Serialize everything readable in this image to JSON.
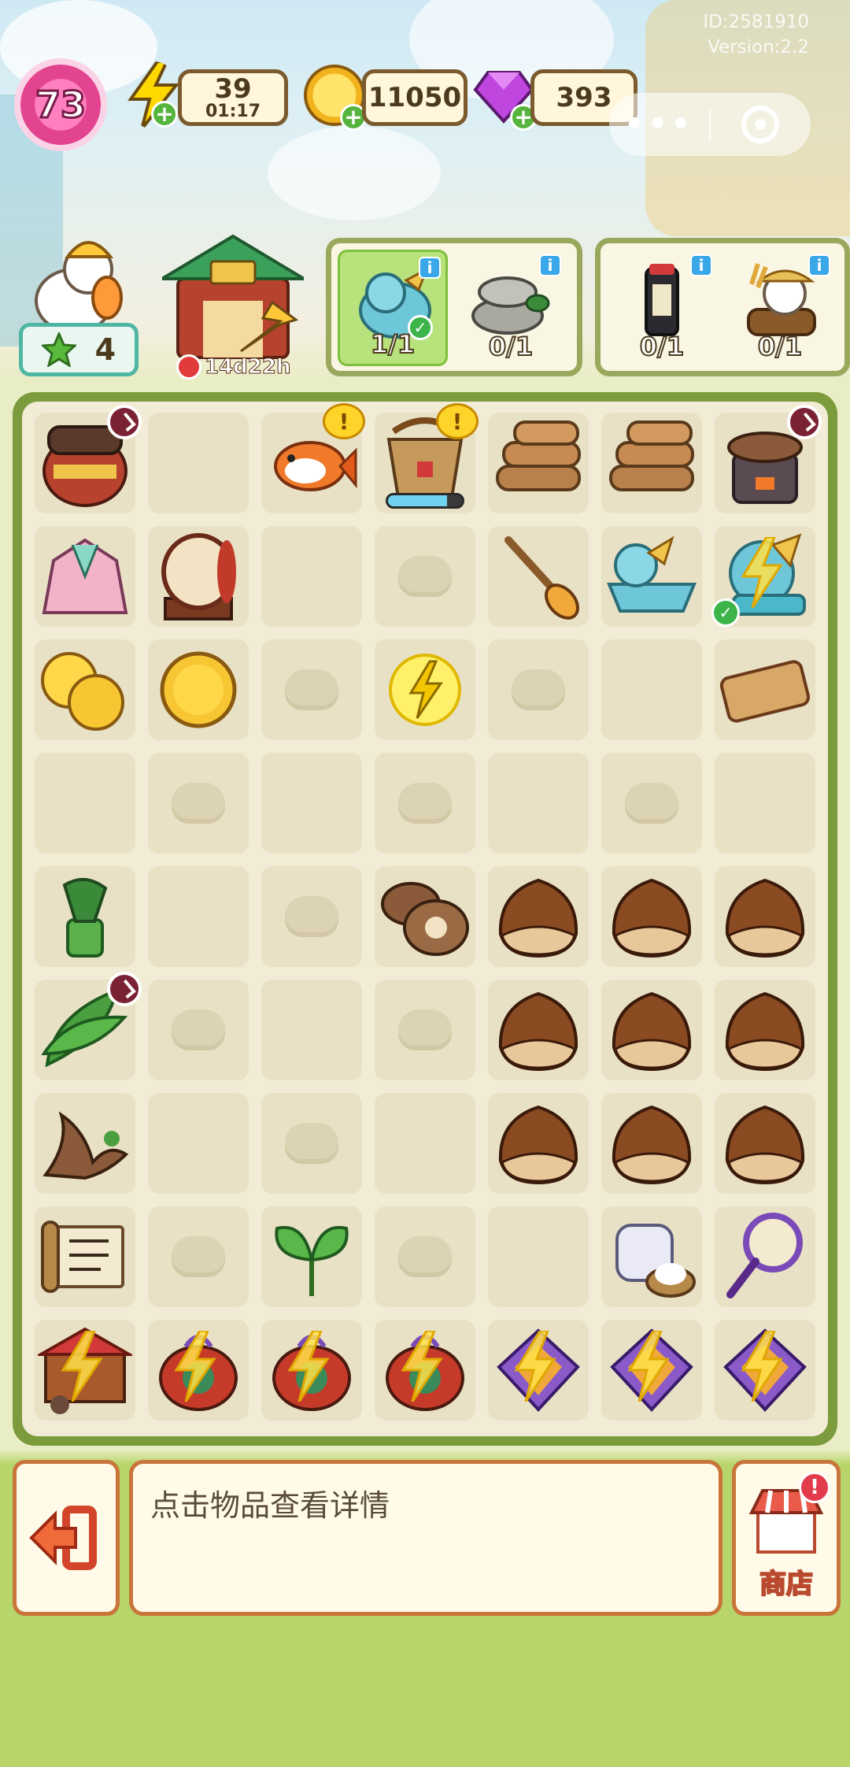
{
  "header": {
    "id_text": "ID:2581910",
    "version_text": "Version:2.2",
    "level": "73",
    "energy": {
      "value": "39",
      "timer": "01:17",
      "icon": "lightning-icon"
    },
    "coins": {
      "value": "11050",
      "icon": "coin-icon"
    },
    "gems": {
      "value": "393",
      "icon": "gem-icon"
    },
    "capsule": {
      "more_label": "•••",
      "target_icon": "target-icon"
    }
  },
  "player": {
    "stars": "4",
    "star_icon": "star-icon"
  },
  "event": {
    "timer": "14d22h",
    "icon": "dragon-boat-gate-icon"
  },
  "orders": [
    {
      "name": "dragon",
      "count": "1/1",
      "complete": true,
      "info": "i"
    },
    {
      "name": "stone-mill",
      "count": "0/1",
      "complete": false,
      "info": "i"
    },
    {
      "name": "ink-stick",
      "count": "0/1",
      "complete": false,
      "info": "i"
    },
    {
      "name": "duck-farmer",
      "count": "0/1",
      "complete": false,
      "info": "i"
    }
  ],
  "board": {
    "rows": [
      [
        "jar",
        "",
        "koi",
        "bucket",
        "logs",
        "logs",
        "stove"
      ],
      [
        "hanfu",
        "drum",
        "",
        "lock",
        "paddle",
        "dragon-boat",
        "dragon-head"
      ],
      [
        "coins-2",
        "coin",
        "lock",
        "energy",
        "lock",
        "",
        "log"
      ],
      [
        "",
        "lock",
        "",
        "lock",
        "",
        "lock",
        ""
      ],
      [
        "mortar",
        "",
        "lock",
        "mushroom",
        "chestnut",
        "chestnut",
        "chestnut"
      ],
      [
        "leaves",
        "lock",
        "",
        "lock",
        "chestnut",
        "chestnut",
        "chestnut"
      ],
      [
        "root",
        "",
        "lock",
        "",
        "chestnut",
        "chestnut",
        "chestnut"
      ],
      [
        "scroll",
        "lock",
        "leaf",
        "lock",
        "",
        "cream",
        "fan"
      ],
      [
        "stall",
        "pouch",
        "pouch",
        "pouch",
        "kite",
        "kite",
        "kite"
      ]
    ],
    "bucket_progress": 0.8
  },
  "footer": {
    "message": "点击物品查看详情",
    "exit_icon": "exit-icon",
    "shop_label": "商店",
    "shop_alert": "!"
  },
  "colors": {
    "accent_green": "#7b9b3c",
    "brown": "#7b5a2e",
    "level_pink": "#e3448f"
  }
}
